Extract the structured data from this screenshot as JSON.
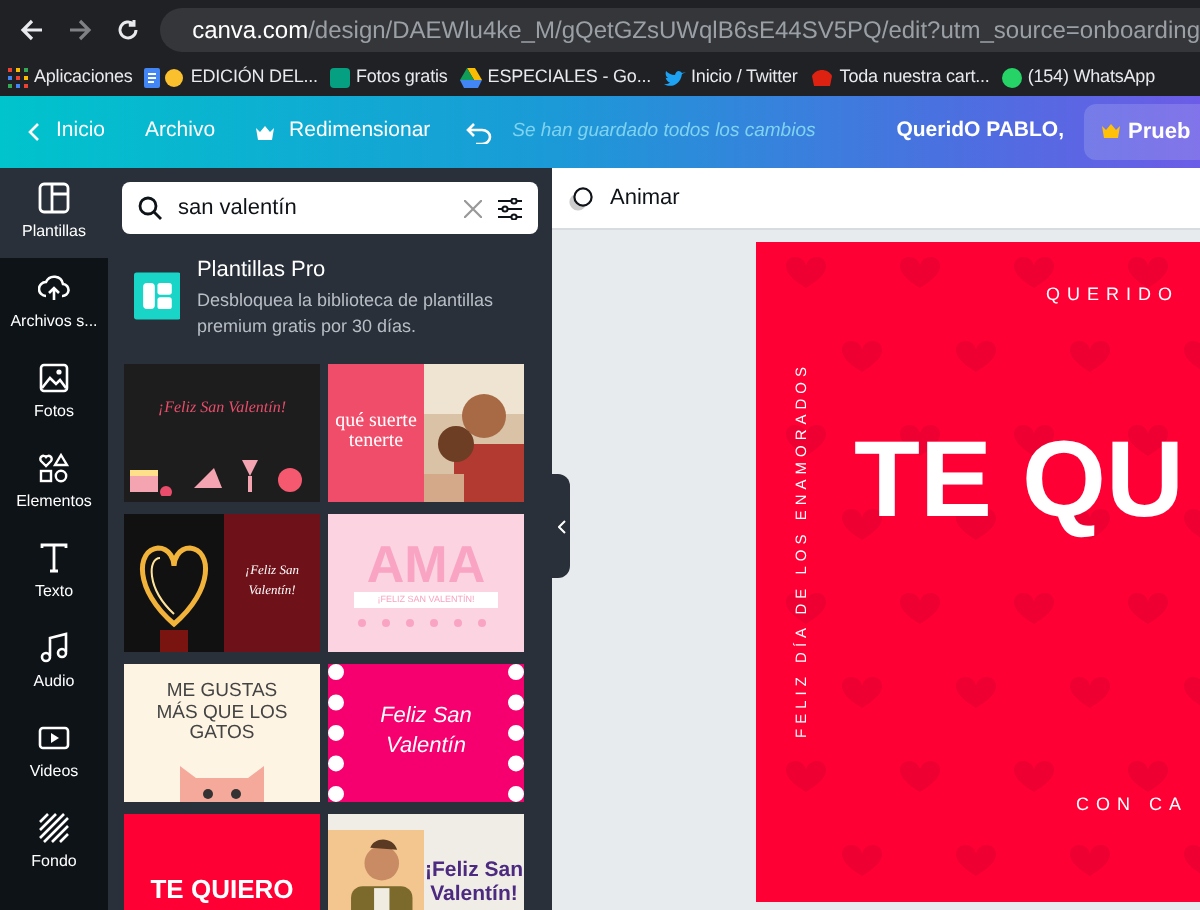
{
  "browser": {
    "url_host": "canva.com",
    "url_path": "/design/DAEWlu4ke_M/gQetGZsUWqlB6sE44SV5PQ/edit?utm_source=onboarding",
    "bookmarks": [
      {
        "label": "Aplicaciones",
        "kind": "apps"
      },
      {
        "label": "EDICIÓN DEL...",
        "kind": "doc"
      },
      {
        "label": "Fotos gratis",
        "kind": "px"
      },
      {
        "label": "ESPECIALES - Go...",
        "kind": "drive"
      },
      {
        "label": "Inicio / Twitter",
        "kind": "bird"
      },
      {
        "label": "Toda nuestra cart...",
        "kind": "red"
      },
      {
        "label": "(154) WhatsApp",
        "kind": "chat"
      }
    ]
  },
  "toolbar": {
    "back": "Inicio",
    "file": "Archivo",
    "resize": "Redimensionar",
    "status": "Se han guardado todos los cambios",
    "title": "QueridO PABLO,",
    "trial": "Prueb"
  },
  "rail": [
    {
      "label": "Plantillas",
      "selected": true
    },
    {
      "label": "Archivos s...",
      "selected": false
    },
    {
      "label": "Fotos",
      "selected": false
    },
    {
      "label": "Elementos",
      "selected": false
    },
    {
      "label": "Texto",
      "selected": false
    },
    {
      "label": "Audio",
      "selected": false
    },
    {
      "label": "Videos",
      "selected": false
    },
    {
      "label": "Fondo",
      "selected": false
    }
  ],
  "search": {
    "value": "san valentín"
  },
  "promo": {
    "title": "Plantillas Pro",
    "text": "Desbloquea la biblioteca de plantillas premium gratis por 30 días."
  },
  "templates": [
    {
      "kind": "dark-cakes",
      "texts": [
        "¡Feliz San Valentín!"
      ]
    },
    {
      "kind": "pink-photo",
      "texts": [
        "qué suerte tenerte"
      ]
    },
    {
      "kind": "sparkler",
      "texts": [
        "¡Feliz San Valentín!"
      ]
    },
    {
      "kind": "ama",
      "texts": [
        "AMA",
        "¡FELIZ SAN VALENTÍN!"
      ]
    },
    {
      "kind": "cats",
      "texts": [
        "ME GUSTAS MÁS QUE LOS GATOS"
      ]
    },
    {
      "kind": "hearts",
      "texts": [
        "Feliz San Valentín"
      ]
    },
    {
      "kind": "red",
      "texts": [
        "TE QUIERO"
      ]
    },
    {
      "kind": "man-photo",
      "texts": [
        "¡Feliz San Valentín!"
      ]
    }
  ],
  "editor": {
    "animate": "Animar",
    "design": {
      "top": "QUERIDO",
      "side": "FELIZ DÍA DE LOS ENAMORADOS",
      "headline": "TE QU",
      "bottom": "CON CA"
    }
  }
}
